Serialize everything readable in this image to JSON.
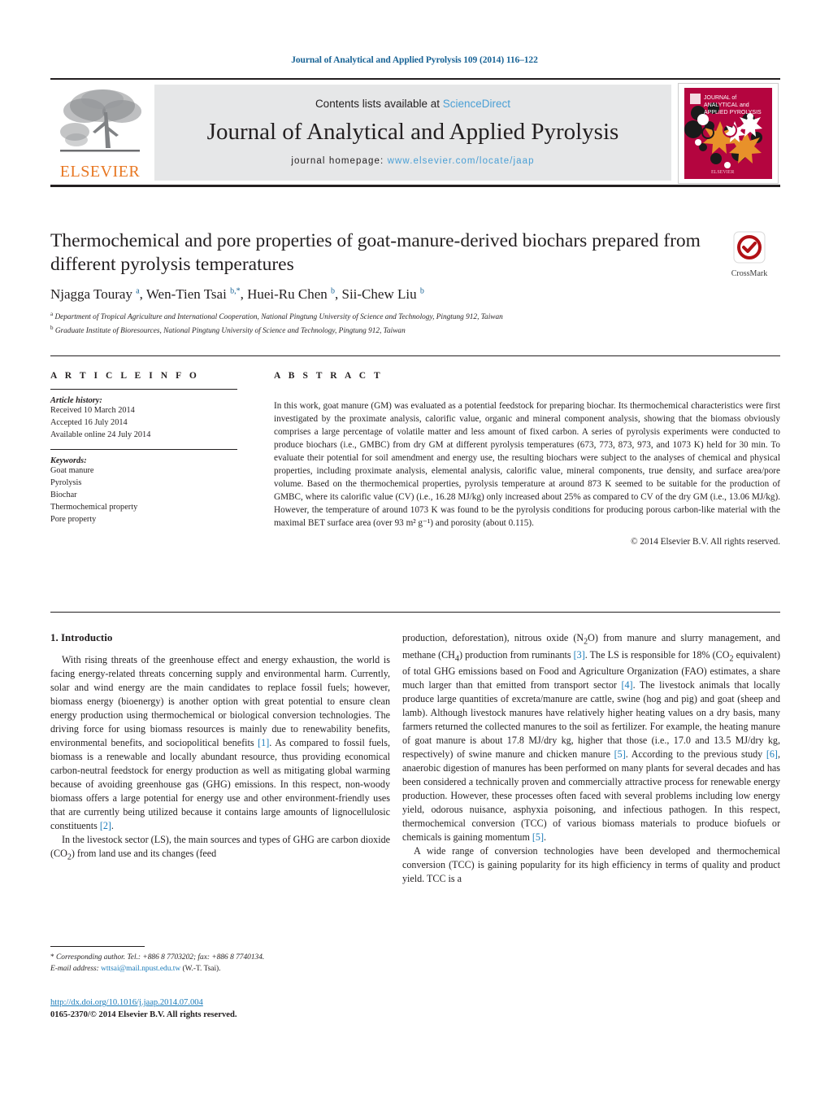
{
  "running_head": "Journal of Analytical and Applied Pyrolysis 109 (2014) 116–122",
  "masthead": {
    "contents_prefix": "Contents lists available at ",
    "contents_link": "ScienceDirect",
    "journal_name": "Journal of Analytical and Applied Pyrolysis",
    "homepage_prefix": "journal homepage: ",
    "homepage_link": "www.elsevier.com/locate/jaap",
    "publisher_wordmark": "ELSEVIER",
    "cover_title_line1": "JOURNAL of",
    "cover_title_line2": "ANALYTICAL and",
    "cover_title_line3": "APPLIED PYROLYSIS"
  },
  "article": {
    "title": "Thermochemical and pore properties of goat-manure-derived biochars prepared from different pyrolysis temperatures",
    "authors_html": "Njagga Touray <sup>a</sup>, Wen-Tien Tsai <sup>b,*</sup>, Huei-Ru Chen <sup>b</sup>, Sii-Chew Liu <sup>b</sup>",
    "affiliation_a": "Department of Tropical Agriculture and International Cooperation, National Pingtung University of Science and Technology, Pingtung 912, Taiwan",
    "affiliation_b": "Graduate Institute of Bioresources, National Pingtung University of Science and Technology, Pingtung 912, Taiwan",
    "crossmark_label": "CrossMark"
  },
  "article_info": {
    "heading": "A R T I C L E    I N F O",
    "history_label": "Article history:",
    "received": "Received 10 March 2014",
    "accepted": "Accepted 16 July 2014",
    "available": "Available online 24 July 2014",
    "keywords_label": "Keywords:",
    "keywords": [
      "Goat manure",
      "Pyrolysis",
      "Biochar",
      "Thermochemical property",
      "Pore property"
    ]
  },
  "abstract": {
    "heading": "A B S T R A C T",
    "text": "In this work, goat manure (GM) was evaluated as a potential feedstock for preparing biochar. Its thermochemical characteristics were first investigated by the proximate analysis, calorific value, organic and mineral component analysis, showing that the biomass obviously comprises a large percentage of volatile matter and less amount of fixed carbon. A series of pyrolysis experiments were conducted to produce biochars (i.e., GMBC) from dry GM at different pyrolysis temperatures (673, 773, 873, 973, and 1073 K) held for 30 min. To evaluate their potential for soil amendment and energy use, the resulting biochars were subject to the analyses of chemical and physical properties, including proximate analysis, elemental analysis, calorific value, mineral components, true density, and surface area/pore volume. Based on the thermochemical properties, pyrolysis temperature at around 873 K seemed to be suitable for the production of GMBC, where its calorific value (CV) (i.e., 16.28 MJ/kg) only increased about 25% as compared to CV of the dry GM (i.e., 13.06 MJ/kg). However, the temperature of around 1073 K was found to be the pyrolysis conditions for producing porous carbon-like material with the maximal BET surface area (over 93 m² g⁻¹) and porosity (about 0.115).",
    "copyright": "© 2014 Elsevier B.V. All rights reserved."
  },
  "body": {
    "section_number_title": "1.  Introductio",
    "left_para_1_html": "With rising threats of the greenhouse effect and energy exhaustion, the world is facing energy-related threats concerning supply and environmental harm. Currently, solar and wind energy are the main candidates to replace fossil fuels; however, biomass energy (bioenergy) is another option with great potential to ensure clean energy production using thermochemical or biological conversion technologies. The driving force for using biomass resources is mainly due to renewability benefits, environmental benefits, and sociopolitical benefits <span class=\"ref\">[1]</span>. As compared to fossil fuels, biomass is a renewable and locally abundant resource, thus providing economical carbon-neutral feedstock for energy production as well as mitigating global warming because of avoiding greenhouse gas (GHG) emissions. In this respect, non-woody biomass offers a large potential for energy use and other environment-friendly uses that are currently being utilized because it contains large amounts of lignocellulosic constituents <span class=\"ref\">[2]</span>.",
    "left_para_2_html": "In the livestock sector (LS), the main sources and types of GHG are carbon dioxide (CO<sub>2</sub>) from land use and its changes (feed",
    "right_para_1_html": "production, deforestation), nitrous oxide (N<sub>2</sub>O) from manure and slurry management, and methane (CH<sub>4</sub>) production from ruminants <span class=\"ref\">[3]</span>. The LS is responsible for 18% (CO<sub>2</sub> equivalent) of total GHG emissions based on Food and Agriculture Organization (FAO) estimates, a share much larger than that emitted from transport sector <span class=\"ref\">[4]</span>. The livestock animals that locally produce large quantities of excreta/manure are cattle, swine (hog and pig) and goat (sheep and lamb). Although livestock manures have relatively higher heating values on a dry basis, many farmers returned the collected manures to the soil as fertilizer. For example, the heating manure of goat manure is about 17.8 MJ/dry kg, higher that those (i.e., 17.0 and 13.5 MJ/dry kg, respectively) of swine manure and chicken manure <span class=\"ref\">[5]</span>. According to the previous study <span class=\"ref\">[6]</span>, anaerobic digestion of manures has been performed on many plants for several decades and has been considered a technically proven and commercially attractive process for renewable energy production. However, these processes often faced with several problems including low energy yield, odorous nuisance, asphyxia poisoning, and infectious pathogen. In this respect, thermochemical conversion (TCC) of various biomass materials to produce biofuels or chemicals is gaining momentum <span class=\"ref\">[5]</span>.",
    "right_para_2_html": "A wide range of conversion technologies have been developed and thermochemical conversion (TCC) is gaining popularity for its high efficiency in terms of quality and product yield. TCC is a"
  },
  "footer": {
    "corresponding_html": "* <span class=\"fn-ital\">Corresponding author. Tel.: +886 8 7703202; fax: +886 8 7740134.</span>",
    "email_label": "E-mail address:",
    "email_address": "wttsai@mail.npust.edu.tw",
    "email_suffix": "(W.-T. Tsai).",
    "doi_url": "http://dx.doi.org/10.1016/j.jaap.2014.07.004",
    "issn_line": "0165-2370/© 2014 Elsevier B.V. All rights reserved."
  },
  "colors": {
    "link_blue": "#1a7bb9",
    "masthead_link": "#4a9fd5",
    "elsevier_orange": "#e87722",
    "cover_crimson": "#b4053f",
    "band_gray": "#e6e7e8"
  }
}
